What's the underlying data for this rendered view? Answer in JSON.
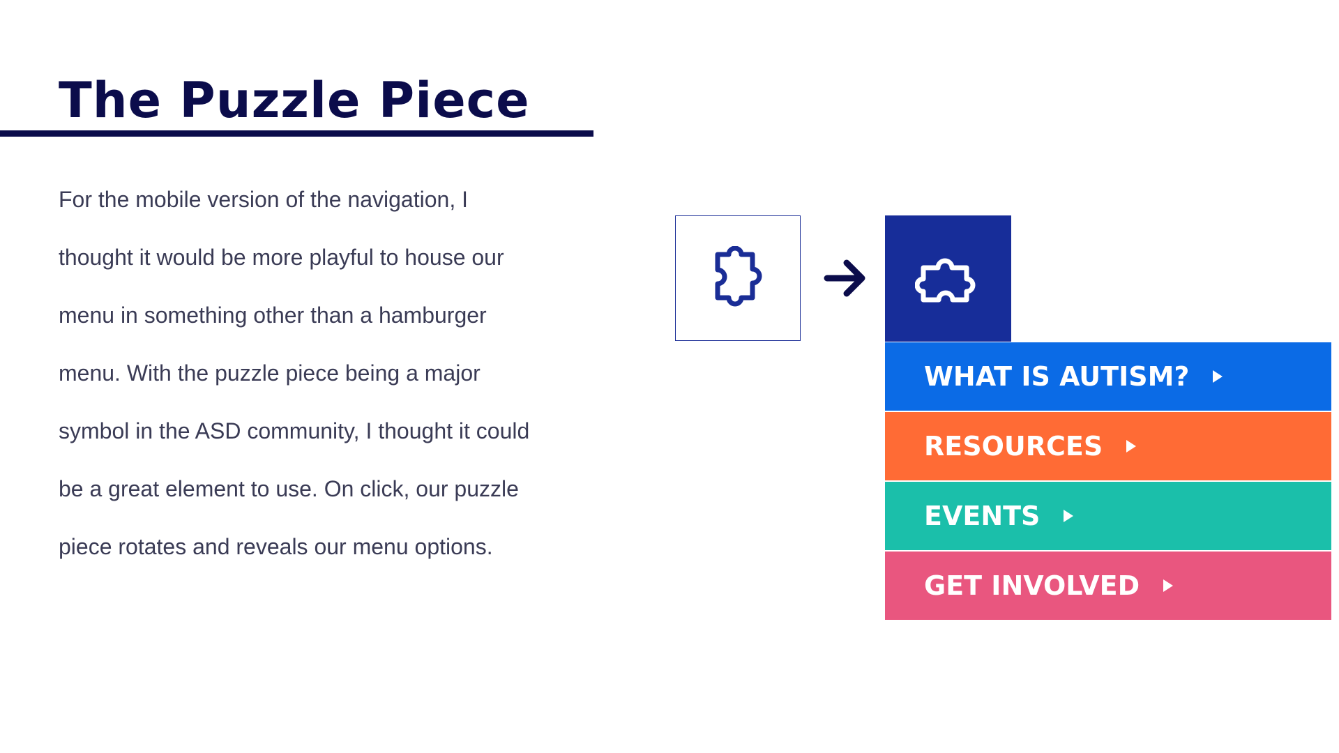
{
  "page": {
    "title": "The Puzzle Piece",
    "body_lines": [
      "For the mobile version of the navigation, I",
      "thought it would be more playful to house our",
      "menu in something other than a hamburger",
      "menu. With the puzzle piece being a major",
      "symbol in the ASD community, I thought it could",
      "be a great element to use. On click, our puzzle",
      "piece rotates and reveals our menu options."
    ]
  },
  "illustration": {
    "closed_icon": "puzzle-piece-icon",
    "transition_icon": "arrow-right-icon",
    "open_icon": "puzzle-piece-rotated-icon"
  },
  "menu": {
    "items": [
      {
        "label": "WHAT IS AUTISM?",
        "color": "#0b6be6",
        "icon": "caret-right-icon"
      },
      {
        "label": "RESOURCES",
        "color": "#ff6b35",
        "icon": "caret-right-icon"
      },
      {
        "label": "EVENTS",
        "color": "#1bbfaa",
        "icon": "caret-right-icon"
      },
      {
        "label": "GET INVOLVED",
        "color": "#e9567f",
        "icon": "caret-right-icon"
      }
    ]
  },
  "colors": {
    "title": "#0b0c4b",
    "body_text": "#3a3b55",
    "brand_blue": "#172d99"
  }
}
